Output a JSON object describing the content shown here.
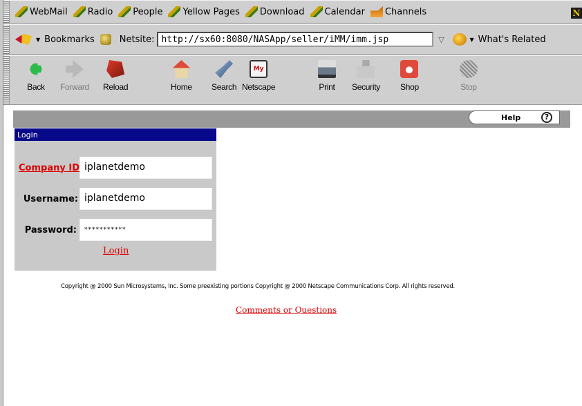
{
  "personal_toolbar": {
    "items": [
      {
        "label": "WebMail",
        "icon": "pencil-icon"
      },
      {
        "label": "Radio",
        "icon": "pencil-icon"
      },
      {
        "label": "People",
        "icon": "pencil-icon"
      },
      {
        "label": "Yellow Pages",
        "icon": "pencil-icon"
      },
      {
        "label": "Download",
        "icon": "pencil-icon"
      },
      {
        "label": "Calendar",
        "icon": "pencil-icon"
      },
      {
        "label": "Channels",
        "icon": "channels-icon"
      }
    ],
    "logo_letter": "N"
  },
  "location_bar": {
    "bookmarks_label": "Bookmarks",
    "netsite_label": "Netsite:",
    "url": "http://sx60:8080/NASApp/seller/iMM/imm.jsp",
    "whats_related_label": "What's Related"
  },
  "nav_toolbar": {
    "buttons": [
      {
        "label": "Back",
        "icon": "back-arrow-icon",
        "enabled": true
      },
      {
        "label": "Forward",
        "icon": "forward-arrow-icon",
        "enabled": false
      },
      {
        "label": "Reload",
        "icon": "reload-icon",
        "enabled": true
      },
      {
        "label": "Home",
        "icon": "home-icon",
        "enabled": true
      },
      {
        "label": "Search",
        "icon": "search-icon",
        "enabled": true
      },
      {
        "label": "Netscape",
        "icon": "my-netscape-icon",
        "enabled": true
      },
      {
        "label": "Print",
        "icon": "printer-icon",
        "enabled": true
      },
      {
        "label": "Security",
        "icon": "lock-icon",
        "enabled": true
      },
      {
        "label": "Shop",
        "icon": "shop-icon",
        "enabled": true
      },
      {
        "label": "Stop",
        "icon": "stop-icon",
        "enabled": false
      }
    ],
    "netscape_icon_text": "My"
  },
  "page": {
    "help_label": "Help",
    "help_icon_text": "?",
    "login_header": "Login",
    "company_label": "Company ID:",
    "company_value": "iplanetdemo",
    "username_label": "Username:",
    "username_value": "iplanetdemo",
    "password_label": "Password:",
    "password_value": "***********",
    "login_link": "Login",
    "copyright": "Copyright @ 2000 Sun Microsystems, Inc. Some preexisting portions Copyright @ 2000 Netscape Communications Corp. All rights reserved.",
    "comments_link": "Comments or Questions"
  },
  "colors": {
    "login_header_bg": "#08088a",
    "link_red": "#d00000",
    "band_gray": "#999999",
    "login_panel_gray": "#c9c9c9"
  }
}
